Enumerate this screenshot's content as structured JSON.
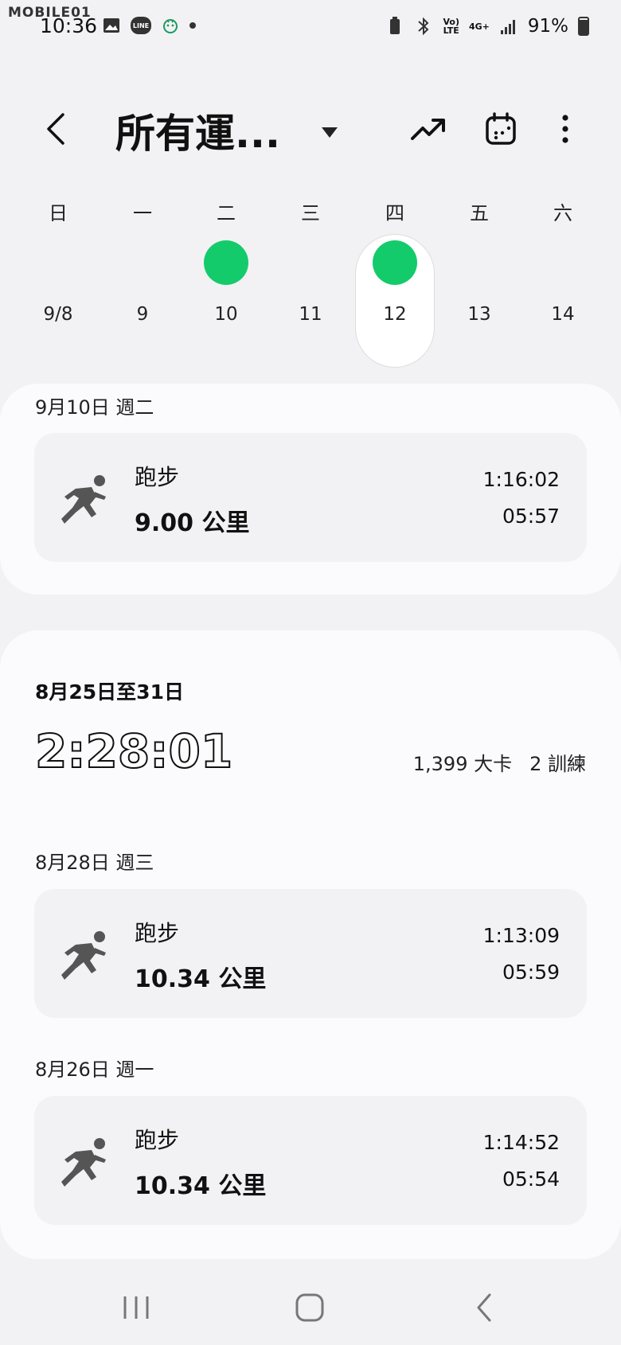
{
  "status": {
    "watermark": "MOBILE01",
    "time": "10:36",
    "network": "4G+",
    "battery": "91%"
  },
  "header": {
    "title": "所有運...",
    "back_icon": "chevron-left-icon",
    "trend_icon": "trend-up-icon",
    "calendar_icon": "calendar-icon",
    "more_icon": "more-vert-icon"
  },
  "week": {
    "days": [
      {
        "name": "日",
        "num": "9/8",
        "has_workout": false
      },
      {
        "name": "一",
        "num": "9",
        "has_workout": false
      },
      {
        "name": "二",
        "num": "10",
        "has_workout": true
      },
      {
        "name": "三",
        "num": "11",
        "has_workout": false
      },
      {
        "name": "四",
        "num": "12",
        "has_workout": true,
        "selected": true
      },
      {
        "name": "五",
        "num": "13",
        "has_workout": false
      },
      {
        "name": "六",
        "num": "14",
        "has_workout": false
      }
    ],
    "accent": "#14cb6c"
  },
  "current": {
    "date": "9月10日 週二",
    "entry": {
      "type": "跑步",
      "distance": "9.00 公里",
      "time": "1:16:02",
      "pace": "05:57"
    }
  },
  "past_week": {
    "range": "8月25日至31日",
    "total": "2:28:01",
    "calories": "1,399 大卡",
    "workouts": "2 訓練",
    "days": [
      {
        "date": "8月28日 週三",
        "type": "跑步",
        "distance": "10.34 公里",
        "time": "1:13:09",
        "pace": "05:59"
      },
      {
        "date": "8月26日 週一",
        "type": "跑步",
        "distance": "10.34 公里",
        "time": "1:14:52",
        "pace": "05:54"
      }
    ]
  }
}
